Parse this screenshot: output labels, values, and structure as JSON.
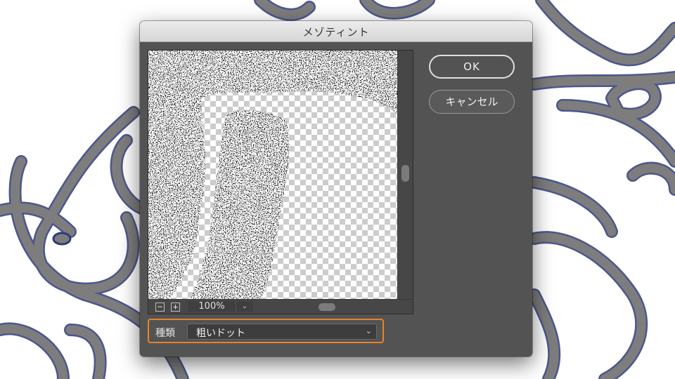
{
  "dialog": {
    "title": "メゾティント",
    "ok_label": "OK",
    "cancel_label": "キャンセル"
  },
  "preview": {
    "zoom_minus_icon": "minus-icon",
    "zoom_plus_icon": "plus-icon",
    "zoom_value": "100%",
    "zoom_dropdown_icon": "chevron-down-icon"
  },
  "type_field": {
    "label": "種類",
    "selected": "粗いドット",
    "caret_icon": "chevron-down-icon"
  },
  "colors": {
    "dialog_bg": "#535353",
    "highlight_border": "#e8822a",
    "art_stroke": "#7d7d7d",
    "art_outline": "#2c3a7a"
  }
}
